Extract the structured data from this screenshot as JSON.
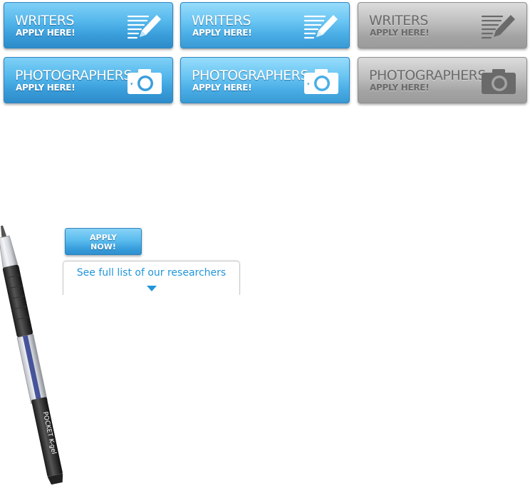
{
  "cards": [
    {
      "title": "WRITERS",
      "subtitle": "APPLY HERE!",
      "icon": "pencil-list-icon",
      "state": "normal"
    },
    {
      "title": "WRITERS",
      "subtitle": "APPLY HERE!",
      "icon": "pencil-list-icon",
      "state": "hover"
    },
    {
      "title": "WRITERS",
      "subtitle": "APPLY HERE!",
      "icon": "pencil-list-icon",
      "state": "disabled"
    },
    {
      "title": "PHOTOGRAPHERS",
      "subtitle": "APPLY HERE!",
      "icon": "camera-icon",
      "state": "normal"
    },
    {
      "title": "PHOTOGRAPHERS",
      "subtitle": "APPLY HERE!",
      "icon": "camera-icon",
      "state": "hover"
    },
    {
      "title": "PHOTOGRAPHERS",
      "subtitle": "APPLY HERE!",
      "icon": "camera-icon",
      "state": "disabled"
    }
  ],
  "apply_now": {
    "label": "APPLY\nNOW!"
  },
  "researchers": {
    "label": "See full list of our researchers"
  },
  "pen_brand": "POCKET K-gel",
  "colors": {
    "accent_blue": "#3a9fdc",
    "link_blue": "#2196d9",
    "disabled_gray": "#a3a3a3"
  }
}
